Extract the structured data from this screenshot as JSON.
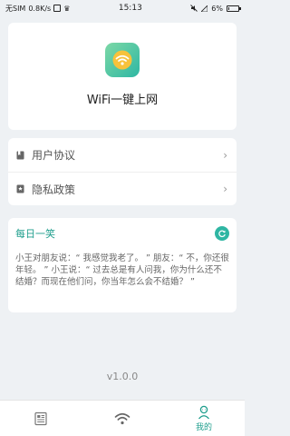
{
  "status_bar": {
    "carrier": "无SIM",
    "speed": "0.8K/s",
    "time": "15:13",
    "battery_text": "6%",
    "battery_level": 0.06
  },
  "app": {
    "title": "WiFi一键上网",
    "icon": "wifi-icon",
    "accent": "#2eb7a3"
  },
  "menu": {
    "items": [
      {
        "label": "用户协议",
        "icon": "bookmark-icon"
      },
      {
        "label": "隐私政策",
        "icon": "star-bookmark-icon"
      }
    ]
  },
  "joke": {
    "title": "每日一笑",
    "text": "小王对朋友说：“ 我感觉我老了。 ” 朋友：“ 不，你还很年轻。 ” 小王说：“ 过去总是有人问我，你为什么还不结婚？而现在他们问，你当年怎么会不结婚？ ”"
  },
  "version": "v1.0.0",
  "tabs": {
    "items": [
      {
        "label": "",
        "icon": "document-icon"
      },
      {
        "label": "",
        "icon": "wifi-icon"
      },
      {
        "label": "我的",
        "icon": "person-icon",
        "active": true
      }
    ]
  }
}
